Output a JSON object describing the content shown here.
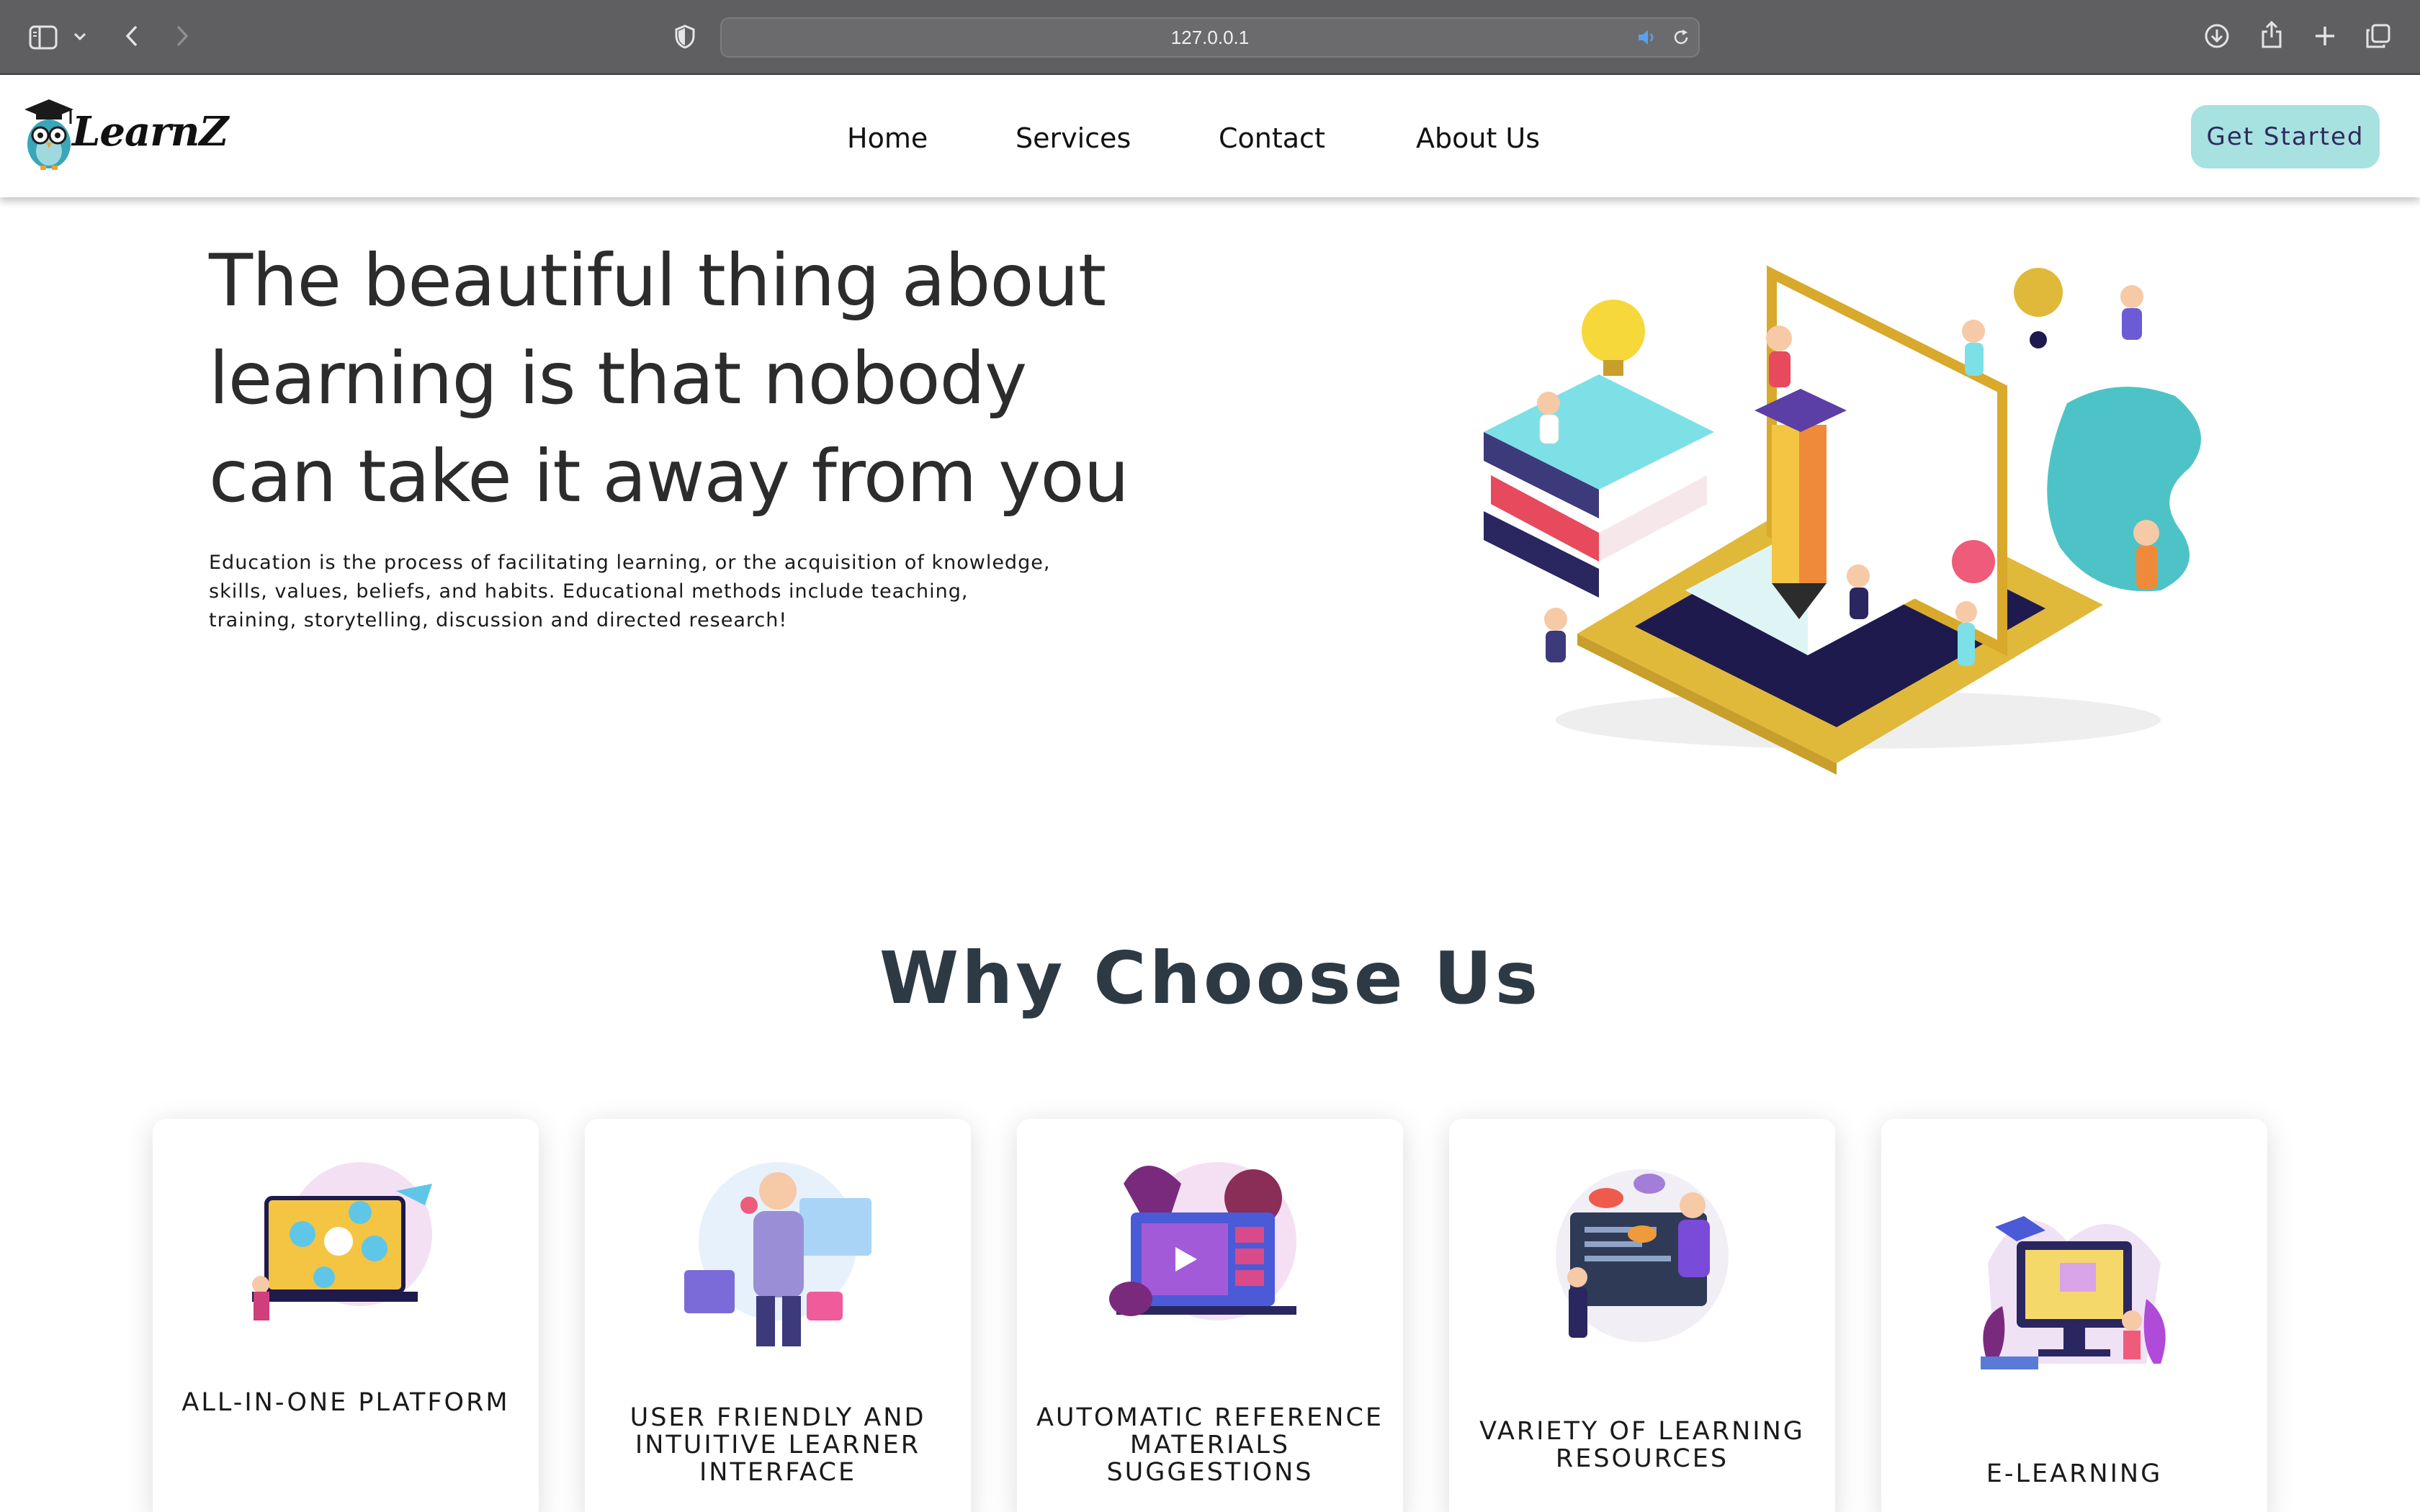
{
  "browser": {
    "url": "127.0.0.1",
    "icons": [
      "sidebar-icon",
      "chevron-down-icon",
      "back-icon",
      "forward-icon",
      "privacy-shield-icon",
      "audio-icon",
      "reload-icon",
      "download-icon",
      "share-icon",
      "new-tab-icon",
      "tabs-overview-icon"
    ]
  },
  "header": {
    "logo_text": "LearnZ",
    "nav": [
      {
        "label": "Home"
      },
      {
        "label": "Services"
      },
      {
        "label": "Contact"
      },
      {
        "label": "About Us"
      }
    ],
    "cta_label": "Get Started",
    "colors": {
      "cta_bg": "#a7e1e0",
      "cta_text": "#2f2a5c"
    }
  },
  "hero": {
    "title_lines": [
      "The beautiful thing about",
      "learning is that nobody",
      "can take it away from you"
    ],
    "description": "Education is the process of facilitating learning, or the acquisition of knowledge, skills, values, beliefs, and habits. Educational methods include teaching, training, storytelling, discussion and directed research!"
  },
  "why": {
    "title": "Why Choose Us",
    "cards": [
      {
        "label": "ALL-IN-ONE PLATFORM"
      },
      {
        "label": "USER FRIENDLY AND INTUITIVE LEARNER INTERFACE"
      },
      {
        "label": "AUTOMATIC REFERENCE MATERIALS SUGGESTIONS"
      },
      {
        "label": "VARIETY OF LEARNING RESOURCES"
      },
      {
        "label": "E-LEARNING"
      }
    ]
  }
}
